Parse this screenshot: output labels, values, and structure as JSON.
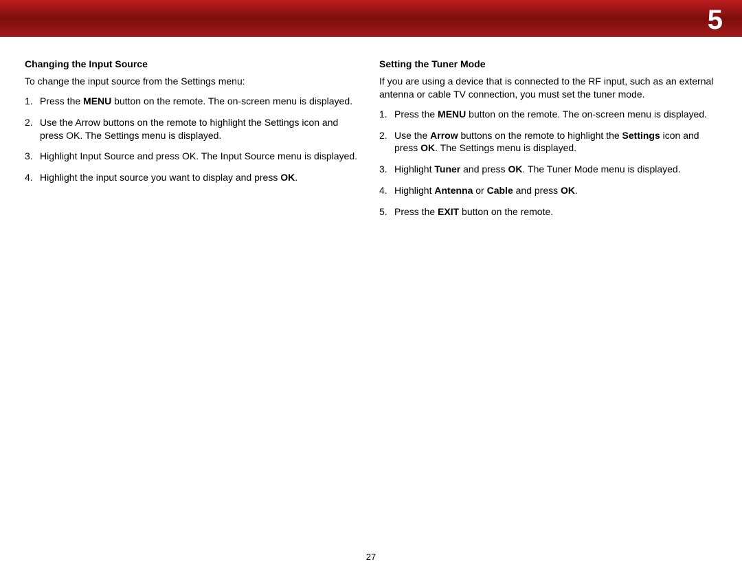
{
  "chapter": "5",
  "page_number": "27",
  "left": {
    "heading": "Changing the Input Source",
    "intro": "To change the input source from the Settings menu:",
    "steps": [
      {
        "pre": "Press the ",
        "b1": "MENU",
        "post1": " button on the remote. The on-screen menu is displayed."
      },
      {
        "pre": "Use the Arrow buttons on the remote to highlight the Settings icon and press OK. The Settings menu is displayed."
      },
      {
        "pre": "Highlight Input Source and press OK. The Input Source menu is displayed."
      },
      {
        "pre": "Highlight the input source you want to display and press ",
        "b1": "OK",
        "post1": "."
      }
    ]
  },
  "right": {
    "heading": "Setting the Tuner Mode",
    "intro": "If you are using a device that is connected to the RF input, such as an external antenna or cable TV connection, you must set the tuner mode.",
    "steps": [
      {
        "pre": "Press the ",
        "b1": "MENU",
        "post1": " button on the remote. The on-screen menu is displayed."
      },
      {
        "pre": "Use the ",
        "b1": "Arrow",
        "post1": " buttons on the remote to highlight the ",
        "b2": "Settings",
        "post2": " icon and press ",
        "b3": "OK",
        "post3": ". The Settings menu is displayed."
      },
      {
        "pre": "Highlight ",
        "b1": "Tuner",
        "post1": " and press ",
        "b2": "OK",
        "post2": ". The Tuner Mode menu is displayed."
      },
      {
        "pre": "Highlight ",
        "b1": "Antenna",
        "post1": " or ",
        "b2": "Cable",
        "post2": " and press ",
        "b3": "OK",
        "post3": "."
      },
      {
        "pre": "Press the ",
        "b1": "EXIT",
        "post1": " button on the remote."
      }
    ]
  }
}
